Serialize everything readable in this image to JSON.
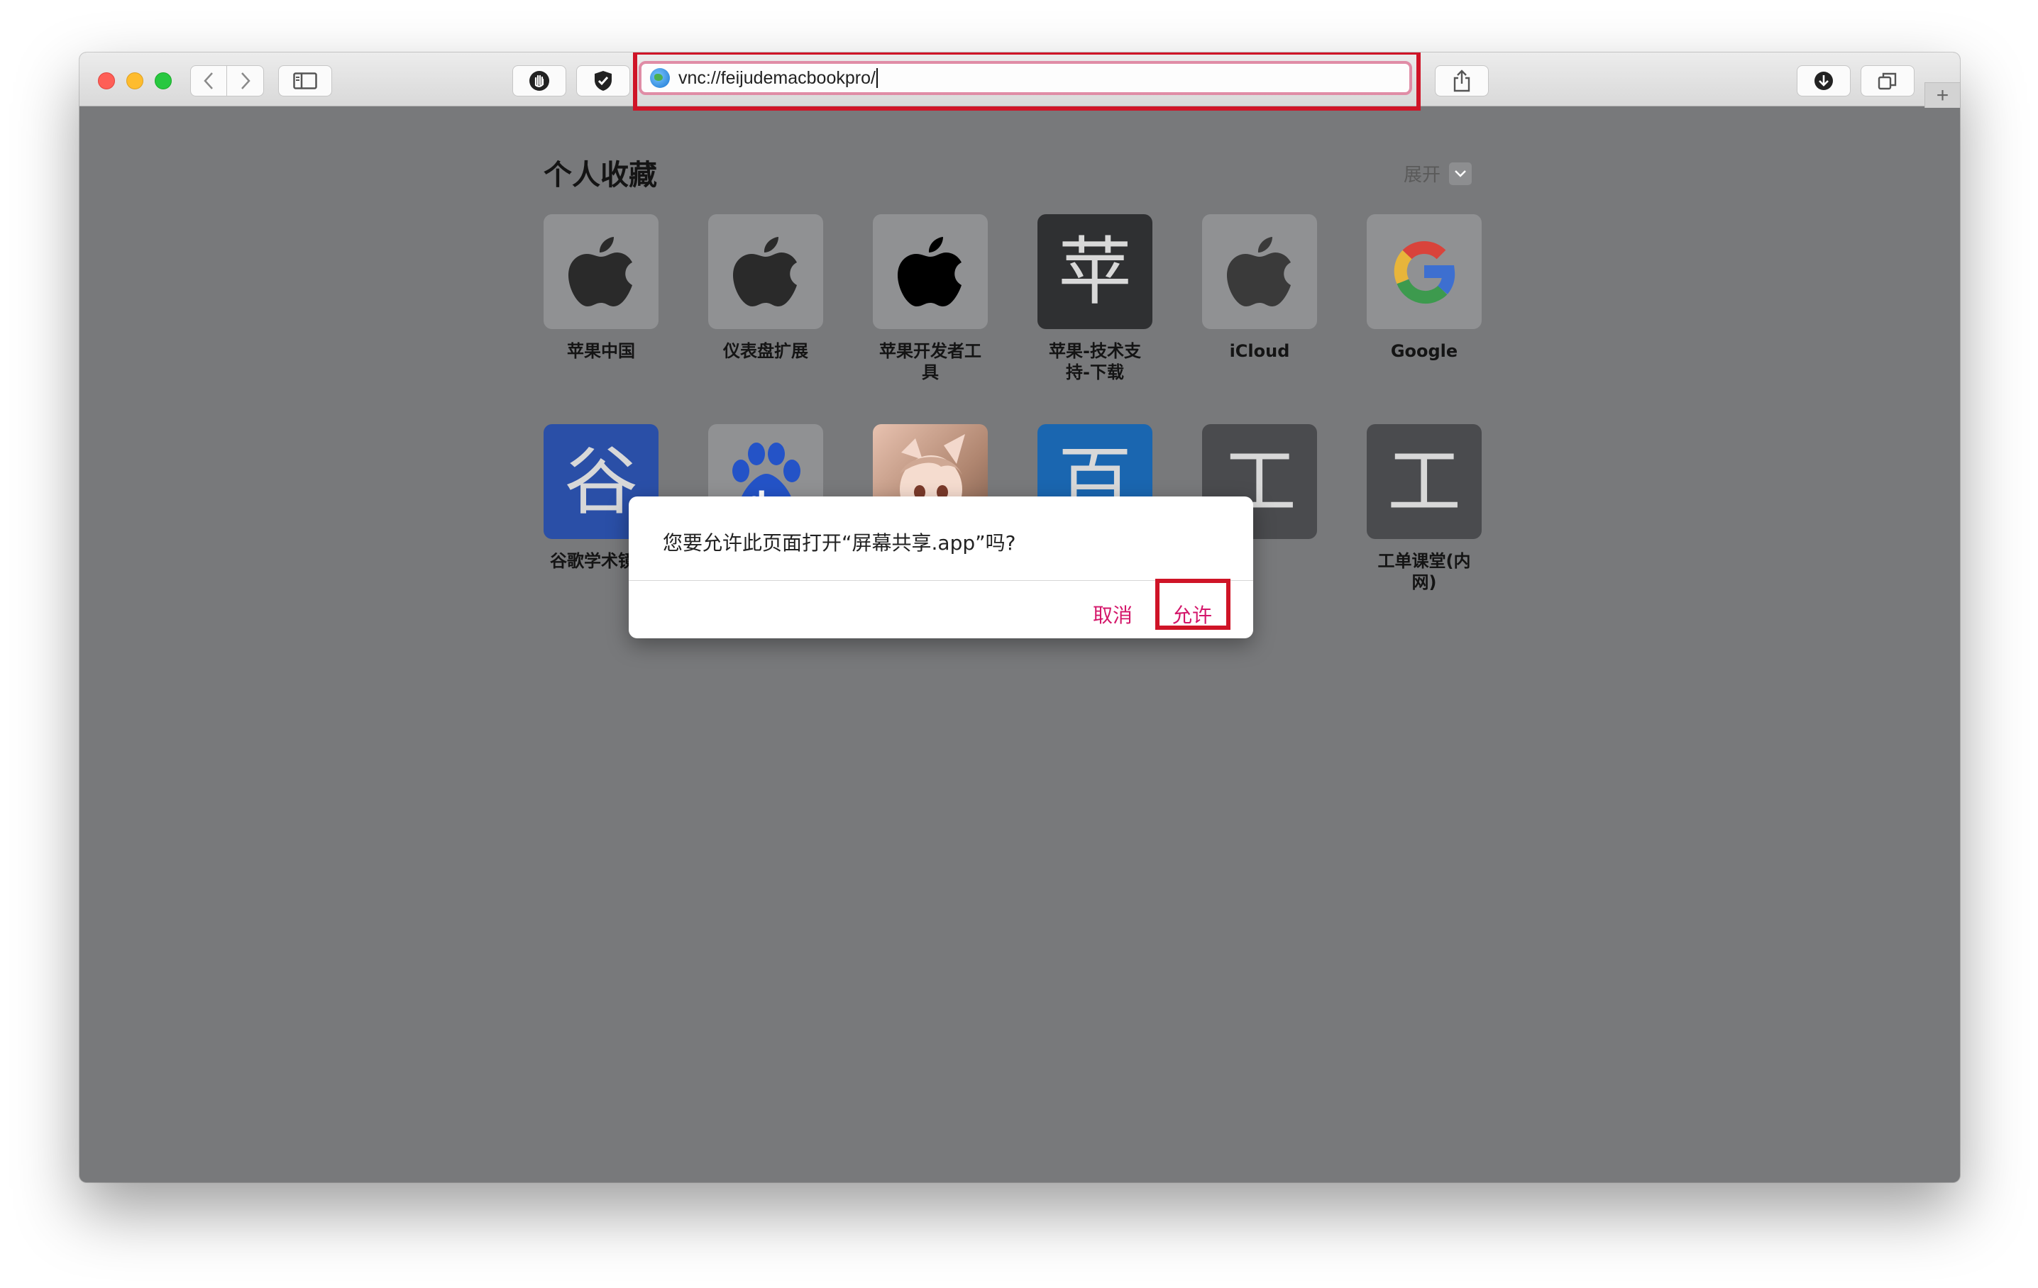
{
  "browser": {
    "address": "vnc://feijudemacbookpro/",
    "new_tab_label": "+"
  },
  "favorites": {
    "title": "个人收藏",
    "expand_label": "展开",
    "items": [
      {
        "label": "苹果中国",
        "icon": "apple-logo-icon",
        "glyph": ""
      },
      {
        "label": "仪表盘扩展",
        "icon": "apple-logo-icon",
        "glyph": ""
      },
      {
        "label": "苹果开发者工具",
        "icon": "apple-logo-icon",
        "glyph": ""
      },
      {
        "label": "苹果-技术支持-下载",
        "icon": "letter-tile-icon",
        "glyph": "苹"
      },
      {
        "label": "iCloud",
        "icon": "apple-logo-icon",
        "glyph": ""
      },
      {
        "label": "Google",
        "icon": "google-g-icon",
        "glyph": ""
      },
      {
        "label": "谷歌学术镜像",
        "icon": "letter-tile-icon",
        "glyph": "谷"
      },
      {
        "label": "",
        "icon": "baidu-paw-icon",
        "glyph": "du"
      },
      {
        "label": "",
        "icon": "anime-thumbnail-icon",
        "glyph": ""
      },
      {
        "label": "",
        "icon": "letter-tile-icon",
        "glyph": "百"
      },
      {
        "label": "",
        "icon": "letter-tile-icon",
        "glyph": "工"
      },
      {
        "label": "工单课堂(内网)",
        "icon": "letter-tile-icon",
        "glyph": "工"
      }
    ]
  },
  "dialog": {
    "message": "您要允许此页面打开“屏幕共享.app”吗?",
    "cancel_label": "取消",
    "allow_label": "允许"
  },
  "colors": {
    "accent": "#d4166a",
    "highlight": "#cf1427"
  }
}
